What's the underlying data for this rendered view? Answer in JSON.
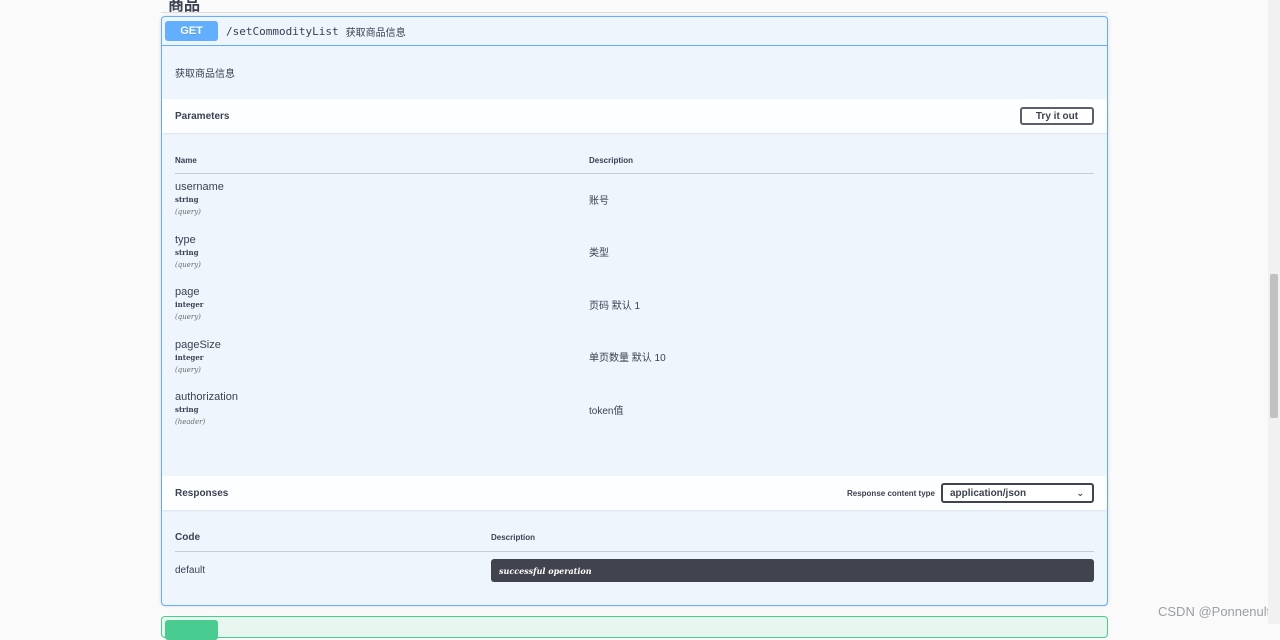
{
  "section": {
    "title": "商品"
  },
  "operation": {
    "method": "GET",
    "path": "/setCommodityList",
    "summary": "获取商品信息",
    "description": "获取商品信息"
  },
  "parameters": {
    "header": "Parameters",
    "try_button": "Try it out",
    "col_name": "Name",
    "col_description": "Description",
    "items": [
      {
        "name": "username",
        "type": "string",
        "in": "(query)",
        "description": "账号"
      },
      {
        "name": "type",
        "type": "string",
        "in": "(query)",
        "description": "类型"
      },
      {
        "name": "page",
        "type": "integer",
        "in": "(query)",
        "description": "页码 默认 1"
      },
      {
        "name": "pageSize",
        "type": "integer",
        "in": "(query)",
        "description": "单页数量 默认 10"
      },
      {
        "name": "authorization",
        "type": "string",
        "in": "(header)",
        "description": "token值"
      }
    ]
  },
  "responses": {
    "header": "Responses",
    "content_type_label": "Response content type",
    "content_type_value": "application/json",
    "col_code": "Code",
    "col_description": "Description",
    "items": [
      {
        "code": "default",
        "description": "successful operation"
      }
    ]
  },
  "watermark": "CSDN @Ponnenult",
  "colors": {
    "get": "#61affe",
    "post": "#49cc90",
    "dark": "#41444e"
  }
}
